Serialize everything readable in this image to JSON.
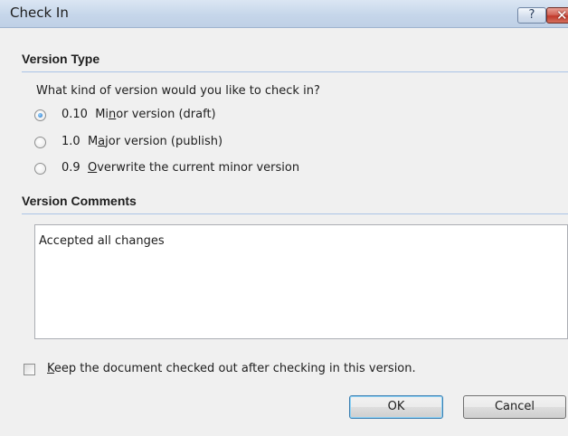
{
  "window": {
    "title": "Check In",
    "help_glyph": "?",
    "close_glyph": "✕"
  },
  "version_type": {
    "heading": "Version Type",
    "question": "What kind of version would you like to check in?",
    "options": [
      {
        "number": "0.10",
        "pre": "Mi",
        "accel": "n",
        "post": "or version (draft)",
        "selected": true
      },
      {
        "number": "1.0",
        "pre": "M",
        "accel": "a",
        "post": "jor version (publish)",
        "selected": false
      },
      {
        "number": "0.9",
        "pre": "",
        "accel": "O",
        "post": "verwrite the current minor version",
        "selected": false
      }
    ]
  },
  "version_comments": {
    "heading": "Version Comments",
    "value": "Accepted all changes"
  },
  "keep_checked_out": {
    "accel": "K",
    "label_rest": "eep the document checked out after checking in this version.",
    "checked": false
  },
  "buttons": {
    "ok": "OK",
    "cancel": "Cancel"
  },
  "colors": {
    "section_rule": "#aac4e6",
    "default_button_border": "#3c7fb1",
    "close_button": "#c0392b"
  }
}
